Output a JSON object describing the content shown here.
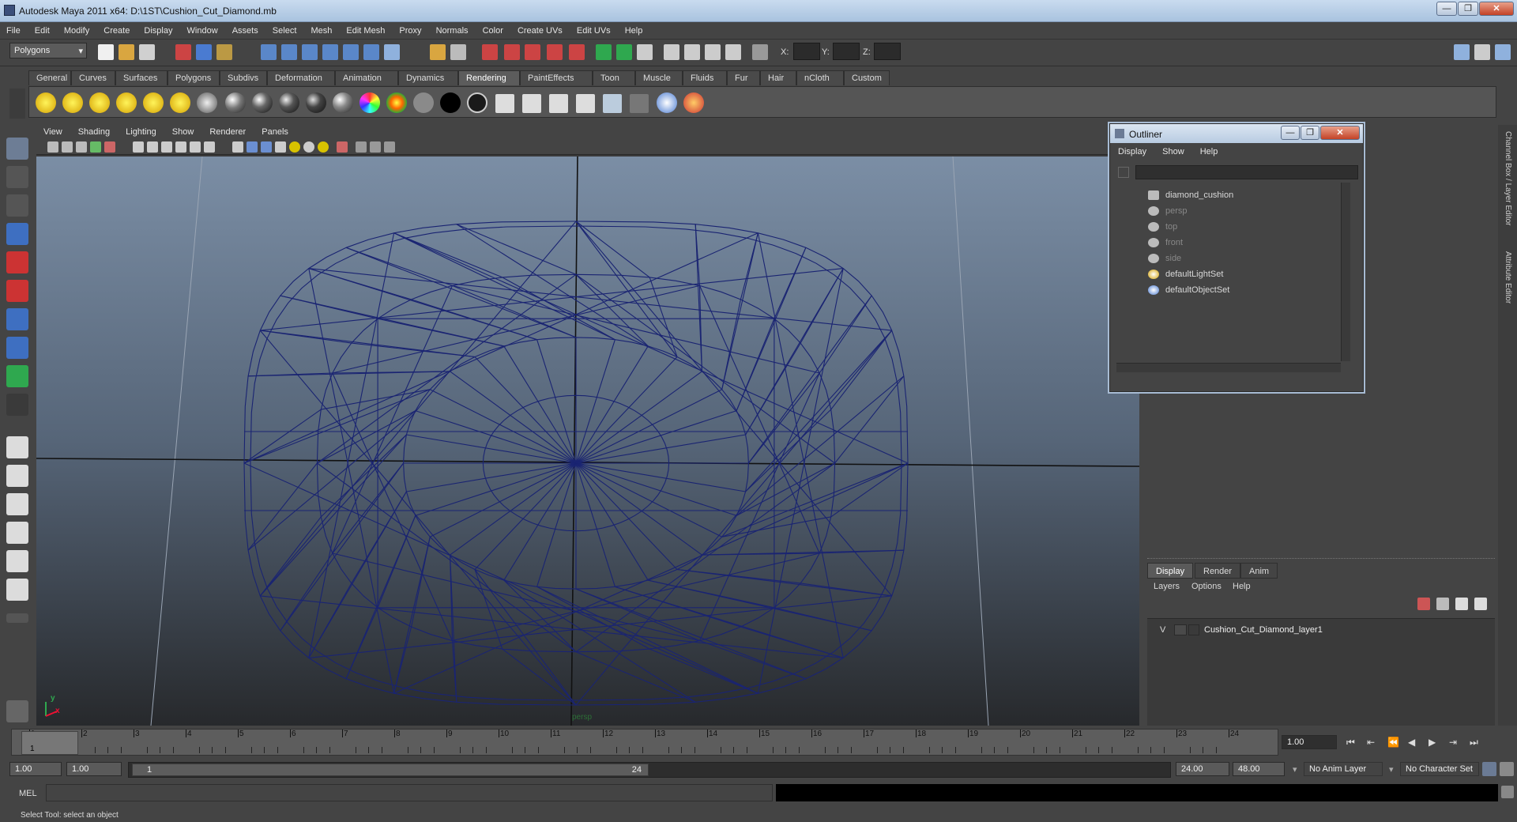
{
  "window": {
    "title": "Autodesk Maya 2011 x64: D:\\1ST\\Cushion_Cut_Diamond.mb",
    "minimize": "—",
    "maximize": "❐",
    "close": "✕"
  },
  "menubar": [
    "File",
    "Edit",
    "Modify",
    "Create",
    "Display",
    "Window",
    "Assets",
    "Select",
    "Mesh",
    "Edit Mesh",
    "Proxy",
    "Normals",
    "Color",
    "Create UVs",
    "Edit UVs",
    "Help"
  ],
  "status": {
    "mode": "Polygons",
    "x_label": "X:",
    "y_label": "Y:",
    "z_label": "Z:"
  },
  "shelf_tabs": [
    "General",
    "Curves",
    "Surfaces",
    "Polygons",
    "Subdivs",
    "Deformation",
    "Animation",
    "Dynamics",
    "Rendering",
    "PaintEffects",
    "Toon",
    "Muscle",
    "Fluids",
    "Fur",
    "Hair",
    "nCloth",
    "Custom"
  ],
  "shelf_active": "Rendering",
  "viewport_menu": [
    "View",
    "Shading",
    "Lighting",
    "Show",
    "Renderer",
    "Panels"
  ],
  "viewport": {
    "camera": "persp",
    "axis_y": "y",
    "axis_x": "x"
  },
  "outliner": {
    "title": "Outliner",
    "menu": [
      "Display",
      "Show",
      "Help"
    ],
    "items": [
      {
        "label": "diamond_cushion",
        "dim": false
      },
      {
        "label": "persp",
        "dim": true
      },
      {
        "label": "top",
        "dim": true
      },
      {
        "label": "front",
        "dim": true
      },
      {
        "label": "side",
        "dim": true
      },
      {
        "label": "defaultLightSet",
        "dim": false
      },
      {
        "label": "defaultObjectSet",
        "dim": false
      }
    ]
  },
  "side_tabs": {
    "channel_box": "Channel Box / Layer Editor",
    "attribute_editor": "Attribute Editor"
  },
  "layer_editor": {
    "tabs": [
      "Display",
      "Render",
      "Anim"
    ],
    "menu": [
      "Layers",
      "Options",
      "Help"
    ],
    "layer_visibility": "V",
    "layer_name": "Cushion_Cut_Diamond_layer1"
  },
  "timeline": {
    "ticks": [
      "1",
      "2",
      "3",
      "4",
      "5",
      "6",
      "7",
      "8",
      "9",
      "10",
      "11",
      "12",
      "13",
      "14",
      "15",
      "16",
      "17",
      "18",
      "19",
      "20",
      "21",
      "22",
      "23",
      "24"
    ],
    "current_frame": "1",
    "current_time": "1.00"
  },
  "range": {
    "start": "1.00",
    "anim_start": "1.00",
    "slider_start": "1",
    "slider_end": "24",
    "end": "24.00",
    "anim_end": "48.00",
    "anim_layer": "No Anim Layer",
    "character_set": "No Character Set"
  },
  "command": {
    "label": "MEL"
  },
  "helpline": "Select Tool: select an object"
}
